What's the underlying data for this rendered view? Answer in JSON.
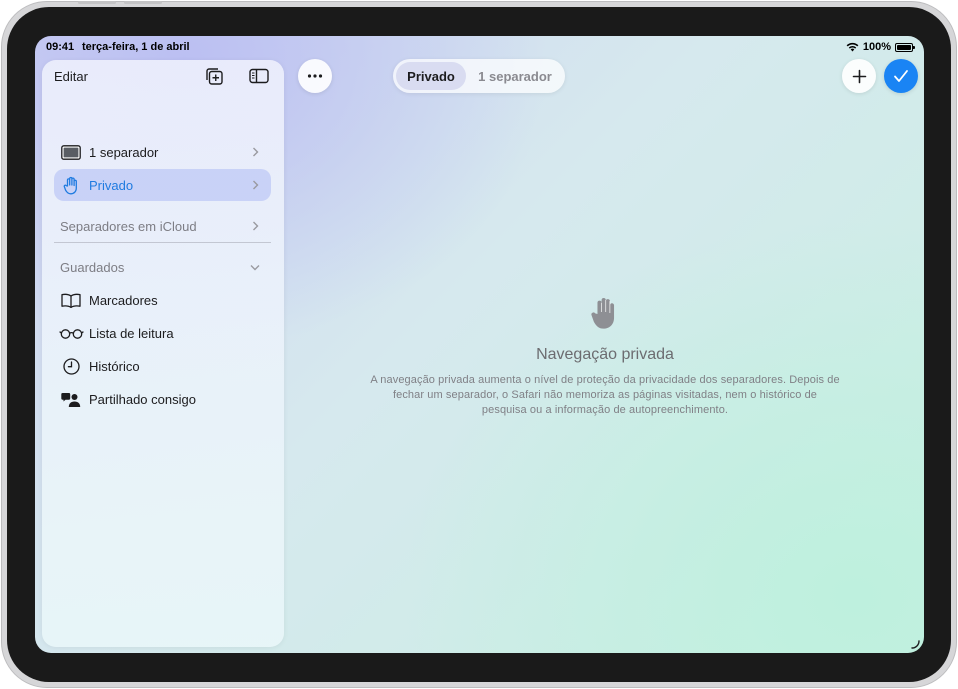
{
  "status_bar": {
    "time": "09:41",
    "date": "terça-feira, 1 de abril",
    "battery_percent": "100%",
    "battery_level": 1.0
  },
  "sidebar": {
    "edit_label": "Editar",
    "tab_groups": [
      {
        "label": "1 separador",
        "icon": "tablet-icon",
        "selected": false
      },
      {
        "label": "Privado",
        "icon": "hand-icon",
        "selected": true
      }
    ],
    "icloud_tabs_label": "Separadores em iCloud",
    "saved_section_label": "Guardados",
    "saved_items": [
      {
        "label": "Marcadores",
        "icon": "book-icon"
      },
      {
        "label": "Lista de leitura",
        "icon": "glasses-icon"
      },
      {
        "label": "Histórico",
        "icon": "clock-icon"
      },
      {
        "label": "Partilhado consigo",
        "icon": "shared-people-icon"
      }
    ]
  },
  "toolbar": {
    "segments": [
      {
        "label": "Privado",
        "active": true
      },
      {
        "label": "1 separador",
        "active": false
      }
    ]
  },
  "empty_state": {
    "title": "Navegação privada",
    "description": "A navegação privada aumenta o nível de proteção da privacidade dos separadores. Depois de fechar um separador, o Safari não memoriza as páginas visitadas, nem o histórico de pesquisa ou a informação de autopreenchimento."
  },
  "colors": {
    "accent": "#1a84f4",
    "selected_row_bg": "#bec8f5",
    "selected_text": "#1f7be0"
  }
}
